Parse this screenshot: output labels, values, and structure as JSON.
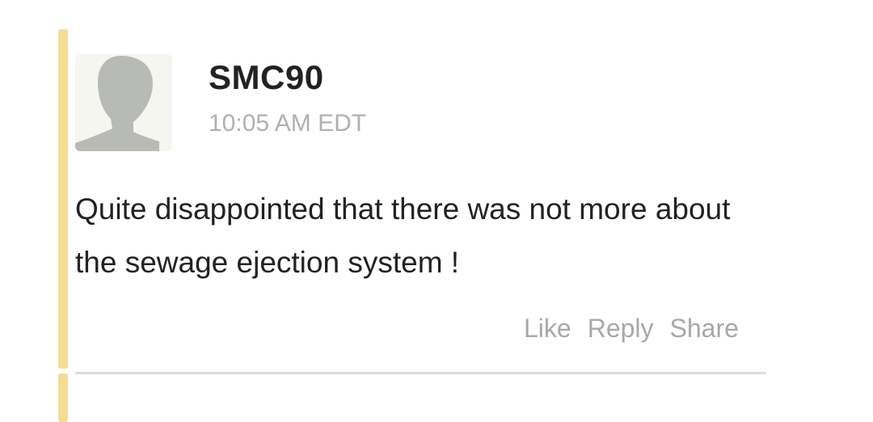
{
  "comment": {
    "author": "SMC90",
    "timestamp": "10:05 AM EDT",
    "text": "Quite disappointed that there was not more about the sewage ejection system !",
    "avatar_icon": "default-user-silhouette-icon",
    "accent_color": "#f5dc93",
    "actions": {
      "like": "Like",
      "reply": "Reply",
      "share": "Share"
    }
  }
}
